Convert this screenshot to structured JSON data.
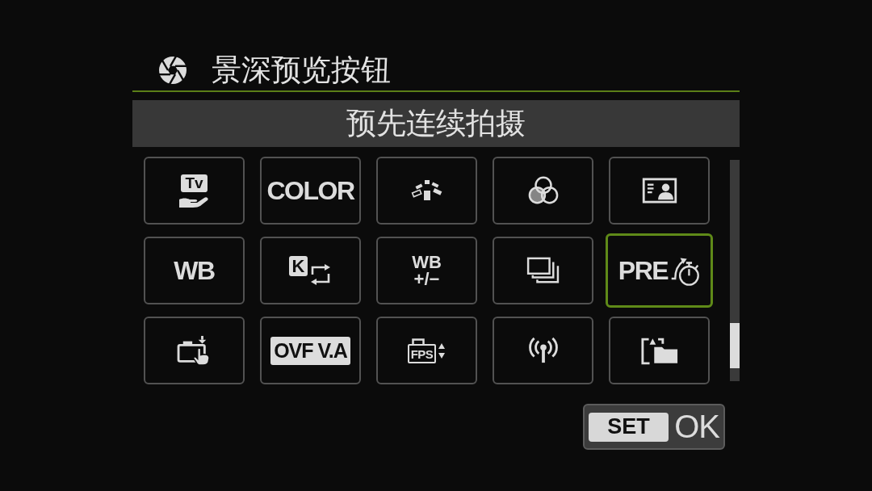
{
  "header": {
    "title": "景深预览按钮"
  },
  "current_function": {
    "label": "预先连续拍摄"
  },
  "functions": [
    {
      "kind": "emblem",
      "text": "Tv",
      "selected": false
    },
    {
      "kind": "label",
      "text": "COLOR",
      "selected": false
    },
    {
      "kind": "icon",
      "selected": false
    },
    {
      "kind": "icon",
      "selected": false
    },
    {
      "kind": "icon",
      "selected": false
    },
    {
      "kind": "label",
      "text": "WB",
      "selected": false
    },
    {
      "kind": "emblem",
      "text": "K",
      "selected": false
    },
    {
      "kind": "stacked",
      "lines": [
        "WB",
        "+/−"
      ],
      "selected": false
    },
    {
      "kind": "icon",
      "selected": false
    },
    {
      "kind": "combo",
      "text": "PRE",
      "selected": true
    },
    {
      "kind": "icon",
      "selected": false
    },
    {
      "kind": "inverse",
      "text": "OVF V.A",
      "selected": false
    },
    {
      "kind": "emblem",
      "text": "FPS",
      "selected": false
    },
    {
      "kind": "icon",
      "selected": false
    },
    {
      "kind": "icon",
      "selected": false
    }
  ],
  "confirm_button": {
    "key": "SET",
    "label": "OK"
  }
}
